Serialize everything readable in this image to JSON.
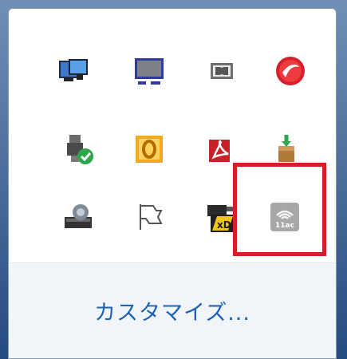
{
  "tray_popup": {
    "icons": [
      {
        "name": "network-monitor-icon"
      },
      {
        "name": "display-icon"
      },
      {
        "name": "dolby-icon"
      },
      {
        "name": "trend-micro-icon"
      },
      {
        "name": "usb-safe-remove-icon"
      },
      {
        "name": "outlook-icon"
      },
      {
        "name": "acrobat-icon"
      },
      {
        "name": "installer-box-icon"
      },
      {
        "name": "storage-drive-icon"
      },
      {
        "name": "flag-icon"
      },
      {
        "name": "xd-card-reader-icon"
      },
      {
        "name": "wifi-11ac-icon",
        "label": "11ac"
      }
    ],
    "customize_label": "カスタマイズ...",
    "highlight_color": "#d21f2a",
    "link_color": "#1c63b7"
  }
}
